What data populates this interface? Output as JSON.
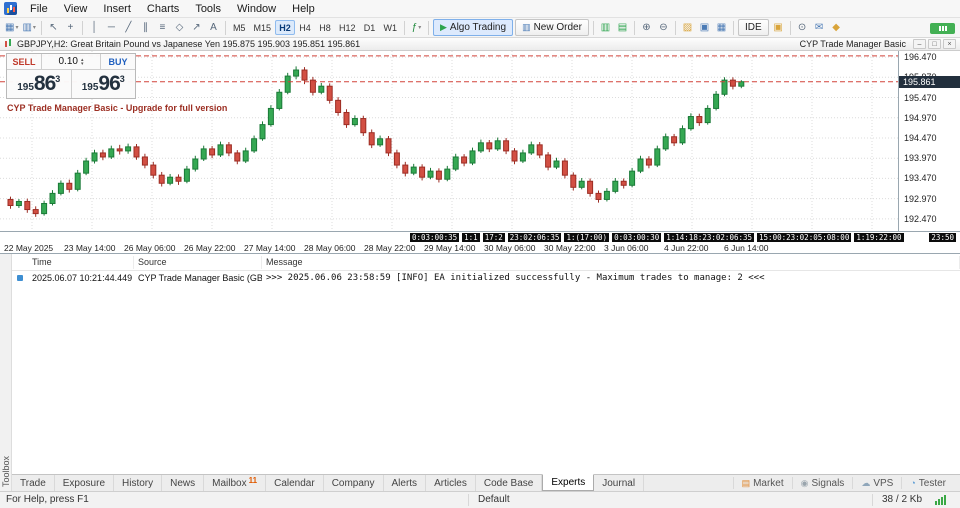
{
  "menu": {
    "items": [
      "File",
      "View",
      "Insert",
      "Charts",
      "Tools",
      "Window",
      "Help"
    ]
  },
  "toolbar": {
    "dropdown_glyph": "▾",
    "items": [
      {
        "name": "new-chart-button",
        "glyph": "▦",
        "color": "#4a7ab5",
        "dropdown": true
      },
      {
        "name": "profiles-button",
        "glyph": "▥",
        "color": "#4a7ab5",
        "dropdown": true
      },
      {
        "type": "sep"
      },
      {
        "name": "cursor-button",
        "glyph": "↖"
      },
      {
        "name": "crosshair-button",
        "glyph": "+"
      },
      {
        "type": "sep"
      },
      {
        "name": "vertical-line-button",
        "glyph": "│"
      },
      {
        "name": "horizontal-line-button",
        "glyph": "─"
      },
      {
        "name": "trendline-button",
        "glyph": "╱"
      },
      {
        "name": "channel-button",
        "glyph": "∥"
      },
      {
        "name": "fibonacci-button",
        "glyph": "≡"
      },
      {
        "name": "shapes-button",
        "glyph": "◇"
      },
      {
        "name": "arrows-button",
        "glyph": "↗"
      },
      {
        "name": "text-button",
        "glyph": "A"
      },
      {
        "type": "sep"
      },
      {
        "type": "tf",
        "label": "M5"
      },
      {
        "type": "tf",
        "label": "M15"
      },
      {
        "type": "tf",
        "label": "H2",
        "active": true
      },
      {
        "type": "tf",
        "label": "H4"
      },
      {
        "type": "tf",
        "label": "H8"
      },
      {
        "type": "tf",
        "label": "H12"
      },
      {
        "type": "tf",
        "label": "D1"
      },
      {
        "type": "tf",
        "label": "W1"
      },
      {
        "type": "sep"
      },
      {
        "name": "indicators-button",
        "glyph": "ƒ",
        "color": "#1f8a3c",
        "dropdown": true
      },
      {
        "type": "sep"
      },
      {
        "type": "button",
        "name": "algo-trading-button",
        "label": "Algo Trading",
        "glyph": "▶",
        "glyph_color": "#2da44e",
        "active": true
      },
      {
        "type": "button",
        "name": "new-order-button",
        "label": "New Order",
        "glyph": "▥",
        "glyph_color": "#4a7ab5"
      },
      {
        "type": "sep"
      },
      {
        "name": "market-depth-button",
        "glyph": "▥",
        "color": "#2da44e"
      },
      {
        "name": "data-window-button",
        "glyph": "▤",
        "color": "#2da44e"
      },
      {
        "type": "sep"
      },
      {
        "name": "zoom-in-button",
        "glyph": "⊕"
      },
      {
        "name": "zoom-out-button",
        "glyph": "⊖"
      },
      {
        "type": "sep"
      },
      {
        "name": "open-data-folder-button",
        "glyph": "▨",
        "color": "#d9a43a"
      },
      {
        "name": "cascade-windows-button",
        "glyph": "▣",
        "color": "#4a7ab5"
      },
      {
        "name": "tile-windows-button",
        "glyph": "▦",
        "color": "#4a7ab5"
      },
      {
        "type": "sep"
      },
      {
        "type": "button",
        "name": "ide-button",
        "label": "IDE"
      },
      {
        "name": "lock-button",
        "glyph": "▣",
        "color": "#d9a43a"
      },
      {
        "type": "sep"
      },
      {
        "name": "search-button",
        "glyph": "⊙"
      },
      {
        "name": "chat-button",
        "glyph": "✉",
        "color": "#4a7ab5"
      },
      {
        "name": "notifications-button",
        "glyph": "◆",
        "color": "#d9a43a"
      }
    ]
  },
  "chart": {
    "titlebar": {
      "title": "GBPJPY,H2: Great Britain Pound vs Japanese Yen  195.875 195.903 195.851 195.861",
      "ea_name": "CYP Trade Manager Basic",
      "window_buttons": [
        {
          "name": "window-minimize-button",
          "glyph": "–"
        },
        {
          "name": "window-restore-button",
          "glyph": "□"
        },
        {
          "name": "window-close-button",
          "glyph": "×"
        }
      ]
    },
    "trade_panel": {
      "sell_label": "SELL",
      "buy_label": "BUY",
      "lot_size": "0.10",
      "lot_up_glyph": "▴",
      "lot_down_glyph": "▾",
      "sell_price_small": "195",
      "sell_price_big": "86",
      "sell_price_sup": "3",
      "buy_price_small": "195",
      "buy_price_big": "96",
      "buy_price_sup": "3"
    },
    "ea_banner": "CYP Trade Manager Basic - Upgrade for full version",
    "current_price": "195.861"
  },
  "chart_data": {
    "type": "candlestick",
    "symbol": "GBPJPY",
    "timeframe": "H2",
    "ylim": [
      192.17,
      196.62
    ],
    "up_color": "#35a853",
    "up_border": "#1b7a38",
    "down_color": "#d24f43",
    "down_border": "#9c2d24",
    "line_color": "#d2433a",
    "bid_price": 195.861,
    "level_line": 196.5,
    "countdown": "23:50",
    "y_ticks": [
      "196.470",
      "195.970",
      "195.470",
      "194.970",
      "194.470",
      "193.970",
      "193.470",
      "192.970",
      "192.470"
    ],
    "x_ticks": [
      "22 May 2025",
      "23 May 14:00",
      "26 May 06:00",
      "26 May 22:00",
      "27 May 14:00",
      "28 May 06:00",
      "28 May 22:00",
      "29 May 14:00",
      "30 May 06:00",
      "30 May 22:00",
      "3 Jun 06:00",
      "4 Jun 22:00",
      "6 Jun 14:00"
    ],
    "axis_marker_boxes": [
      "0:03:00:35",
      "1:1",
      "17:2",
      "23:02:06:35",
      "1:(17:00)",
      "0:03:00:30",
      "1:14:18:23:02:06:35",
      "15:00:23:02:05:08:00",
      "1:19:22:00"
    ],
    "ohlc": [
      [
        192.95,
        193.02,
        192.72,
        192.8
      ],
      [
        192.8,
        192.96,
        192.74,
        192.9
      ],
      [
        192.9,
        192.97,
        192.62,
        192.7
      ],
      [
        192.7,
        192.78,
        192.52,
        192.6
      ],
      [
        192.6,
        192.92,
        192.55,
        192.85
      ],
      [
        192.85,
        193.18,
        192.8,
        193.1
      ],
      [
        193.1,
        193.42,
        193.05,
        193.35
      ],
      [
        193.35,
        193.44,
        193.12,
        193.2
      ],
      [
        193.2,
        193.68,
        193.15,
        193.6
      ],
      [
        193.6,
        193.98,
        193.55,
        193.9
      ],
      [
        193.9,
        194.18,
        193.84,
        194.1
      ],
      [
        194.1,
        194.18,
        193.92,
        194.0
      ],
      [
        194.0,
        194.28,
        193.95,
        194.2
      ],
      [
        194.2,
        194.3,
        194.06,
        194.15
      ],
      [
        194.15,
        194.33,
        194.08,
        194.25
      ],
      [
        194.25,
        194.32,
        193.93,
        194.0
      ],
      [
        194.0,
        194.08,
        193.72,
        193.8
      ],
      [
        193.8,
        193.88,
        193.47,
        193.55
      ],
      [
        193.55,
        193.63,
        193.27,
        193.35
      ],
      [
        193.35,
        193.58,
        193.3,
        193.5
      ],
      [
        193.5,
        193.57,
        193.31,
        193.4
      ],
      [
        193.4,
        193.78,
        193.35,
        193.7
      ],
      [
        193.7,
        194.03,
        193.64,
        193.95
      ],
      [
        193.95,
        194.28,
        193.9,
        194.2
      ],
      [
        194.2,
        194.27,
        193.97,
        194.05
      ],
      [
        194.05,
        194.38,
        194.0,
        194.3
      ],
      [
        194.3,
        194.37,
        194.02,
        194.1
      ],
      [
        194.1,
        194.17,
        193.82,
        193.9
      ],
      [
        193.9,
        194.23,
        193.85,
        194.15
      ],
      [
        194.15,
        194.53,
        194.1,
        194.45
      ],
      [
        194.45,
        194.88,
        194.4,
        194.8
      ],
      [
        194.8,
        195.28,
        194.75,
        195.2
      ],
      [
        195.2,
        195.68,
        195.15,
        195.6
      ],
      [
        195.6,
        196.08,
        195.55,
        196.0
      ],
      [
        196.0,
        196.24,
        195.92,
        196.15
      ],
      [
        196.15,
        196.22,
        195.8,
        195.9
      ],
      [
        195.9,
        195.98,
        195.52,
        195.6
      ],
      [
        195.6,
        195.83,
        195.55,
        195.75
      ],
      [
        195.75,
        195.82,
        195.32,
        195.4
      ],
      [
        195.4,
        195.48,
        195.02,
        195.1
      ],
      [
        195.1,
        195.18,
        194.72,
        194.8
      ],
      [
        194.8,
        195.03,
        194.75,
        194.95
      ],
      [
        194.95,
        195.02,
        194.52,
        194.6
      ],
      [
        194.6,
        194.68,
        194.22,
        194.3
      ],
      [
        194.3,
        194.53,
        194.25,
        194.45
      ],
      [
        194.45,
        194.52,
        194.02,
        194.1
      ],
      [
        194.1,
        194.18,
        193.72,
        193.8
      ],
      [
        193.8,
        193.88,
        193.52,
        193.6
      ],
      [
        193.6,
        193.83,
        193.55,
        193.75
      ],
      [
        193.75,
        193.82,
        193.42,
        193.5
      ],
      [
        193.5,
        193.73,
        193.45,
        193.65
      ],
      [
        193.65,
        193.72,
        193.37,
        193.45
      ],
      [
        193.45,
        193.78,
        193.4,
        193.7
      ],
      [
        193.7,
        194.08,
        193.65,
        194.0
      ],
      [
        194.0,
        194.07,
        193.77,
        193.85
      ],
      [
        193.85,
        194.23,
        193.8,
        194.15
      ],
      [
        194.15,
        194.43,
        194.1,
        194.35
      ],
      [
        194.35,
        194.42,
        194.12,
        194.2
      ],
      [
        194.2,
        194.48,
        194.15,
        194.4
      ],
      [
        194.4,
        194.47,
        194.07,
        194.15
      ],
      [
        194.15,
        194.22,
        193.82,
        193.9
      ],
      [
        193.9,
        194.18,
        193.85,
        194.1
      ],
      [
        194.1,
        194.38,
        194.05,
        194.3
      ],
      [
        194.3,
        194.37,
        193.97,
        194.05
      ],
      [
        194.05,
        194.12,
        193.67,
        193.75
      ],
      [
        193.75,
        193.98,
        193.7,
        193.9
      ],
      [
        193.9,
        193.97,
        193.47,
        193.55
      ],
      [
        193.55,
        193.62,
        193.17,
        193.25
      ],
      [
        193.25,
        193.48,
        193.2,
        193.4
      ],
      [
        193.4,
        193.47,
        193.02,
        193.1
      ],
      [
        193.1,
        193.17,
        192.87,
        192.95
      ],
      [
        192.95,
        193.23,
        192.9,
        193.15
      ],
      [
        193.15,
        193.48,
        193.1,
        193.4
      ],
      [
        193.4,
        193.47,
        193.22,
        193.3
      ],
      [
        193.3,
        193.73,
        193.25,
        193.65
      ],
      [
        193.65,
        194.03,
        193.6,
        193.95
      ],
      [
        193.95,
        194.02,
        193.72,
        193.8
      ],
      [
        193.8,
        194.28,
        193.75,
        194.2
      ],
      [
        194.2,
        194.58,
        194.15,
        194.5
      ],
      [
        194.5,
        194.57,
        194.27,
        194.35
      ],
      [
        194.35,
        194.78,
        194.3,
        194.7
      ],
      [
        194.7,
        195.08,
        194.65,
        195.0
      ],
      [
        195.0,
        195.07,
        194.77,
        194.85
      ],
      [
        194.85,
        195.28,
        194.8,
        195.2
      ],
      [
        195.2,
        195.63,
        195.15,
        195.55
      ],
      [
        195.55,
        195.97,
        195.5,
        195.9
      ],
      [
        195.9,
        195.97,
        195.67,
        195.75
      ],
      [
        195.75,
        195.9,
        195.7,
        195.861
      ]
    ]
  },
  "toolbox": {
    "caption": "Toolbox",
    "columns": [
      "Time",
      "Source",
      "Message"
    ],
    "rows": [
      {
        "time": "2025.06.07 10:21:44.449",
        "source": "CYP Trade Manager Basic (GBP...",
        "message": ">>> 2025.06.06 23:58:59 [INFO] EA initialized successfully - Maximum trades to manage: 2 <<<"
      }
    ],
    "tabs": [
      "Trade",
      "Exposure",
      "History",
      "News",
      "Mailbox",
      "Calendar",
      "Company",
      "Alerts",
      "Articles",
      "Code Base",
      "Experts",
      "Journal"
    ],
    "active_tab": "Experts",
    "mailbox_badge": "11",
    "right_items": [
      {
        "name": "market-button",
        "label": "Market",
        "glyph": "▤",
        "color": "#e0862c"
      },
      {
        "name": "signals-button",
        "label": "Signals",
        "glyph": "◉",
        "color": "#9aa5ad"
      },
      {
        "name": "vps-button",
        "label": "VPS",
        "glyph": "☁",
        "color": "#8fa6ba"
      },
      {
        "name": "tester-button",
        "label": "Tester",
        "glyph": "◔",
        "color": "#5a9bd5"
      }
    ]
  },
  "statusbar": {
    "help": "For Help, press F1",
    "profile": "Default",
    "traffic": "38 / 2 Kb"
  }
}
